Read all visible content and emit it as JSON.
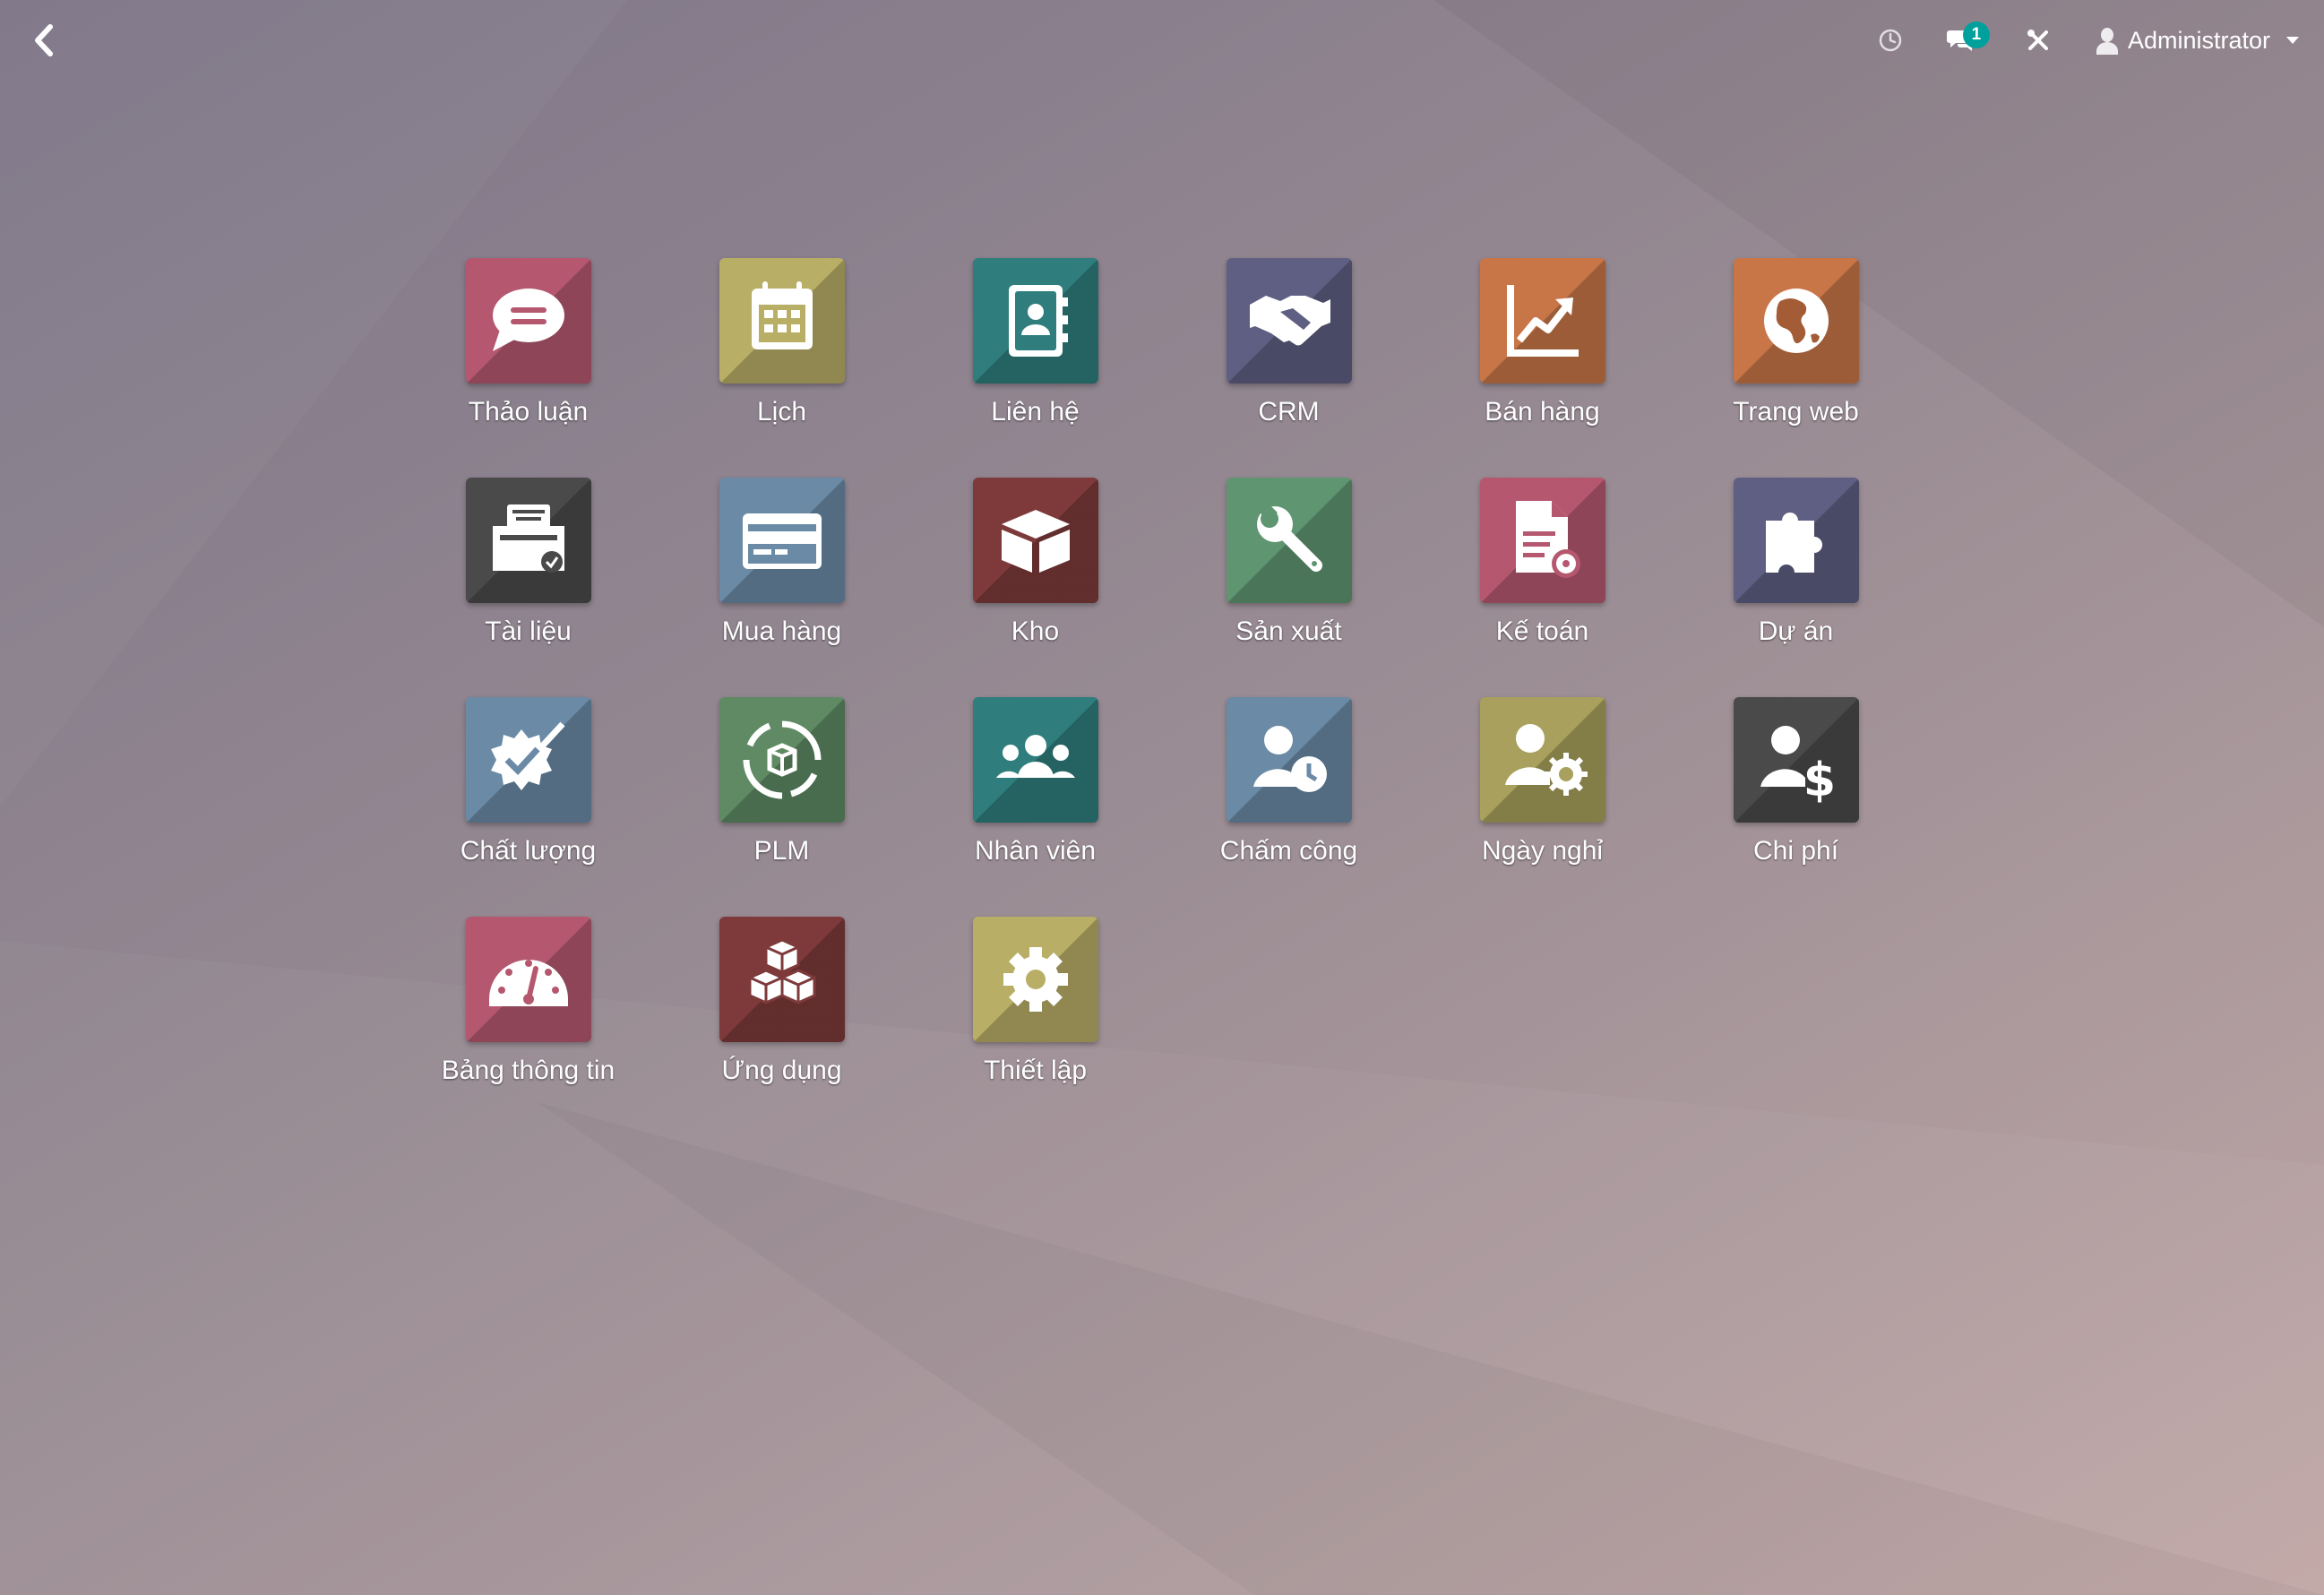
{
  "topbar": {
    "back_icon": "chevron-left-icon",
    "clock_icon": "clock-icon",
    "chat_icon": "chat-bubbles-icon",
    "chat_badge": "1",
    "debug_icon": "debug-tools-icon",
    "user_icon": "user-avatar-icon",
    "user_name": "Administrator"
  },
  "apps": [
    {
      "label": "Thảo luận",
      "icon": "discuss-chat-icon",
      "color": "#b5586f"
    },
    {
      "label": "Lịch",
      "icon": "calendar-icon",
      "color": "#b8ae66"
    },
    {
      "label": "Liên hệ",
      "icon": "contacts-book-icon",
      "color": "#2f7d7d"
    },
    {
      "label": "CRM",
      "icon": "handshake-icon",
      "color": "#5e5f82"
    },
    {
      "label": "Bán hàng",
      "icon": "sales-chart-icon",
      "color": "#c87648"
    },
    {
      "label": "Trang web",
      "icon": "globe-icon",
      "color": "#c87648"
    },
    {
      "label": "Tài liệu",
      "icon": "documents-tray-icon",
      "color": "#4a4a4a"
    },
    {
      "label": "Mua hàng",
      "icon": "credit-card-icon",
      "color": "#6a8aa5"
    },
    {
      "label": "Kho",
      "icon": "box-icon",
      "color": "#7e3a3a"
    },
    {
      "label": "Sản xuất",
      "icon": "wrench-icon",
      "color": "#5f9671"
    },
    {
      "label": "Kế toán",
      "icon": "invoice-gear-icon",
      "color": "#b5586f"
    },
    {
      "label": "Dự án",
      "icon": "puzzle-icon",
      "color": "#5e5f82"
    },
    {
      "label": "Chất lượng",
      "icon": "quality-badge-icon",
      "color": "#6a8aa5"
    },
    {
      "label": "PLM",
      "icon": "plm-cycle-icon",
      "color": "#5f8a64"
    },
    {
      "label": "Nhân viên",
      "icon": "employees-icon",
      "color": "#2f7d7d"
    },
    {
      "label": "Chấm công",
      "icon": "attendance-clock-icon",
      "color": "#6a8aa5"
    },
    {
      "label": "Ngày nghỉ",
      "icon": "time-off-gear-icon",
      "color": "#a8a05c"
    },
    {
      "label": "Chi phí",
      "icon": "expense-dollar-icon",
      "color": "#4a4a4a"
    },
    {
      "label": "Bảng thông tin",
      "icon": "dashboard-gauge-icon",
      "color": "#b5586f"
    },
    {
      "label": "Ứng dụng",
      "icon": "apps-cubes-icon",
      "color": "#7e3a3a"
    },
    {
      "label": "Thiết lập",
      "icon": "settings-gear-icon",
      "color": "#b8ae66"
    }
  ]
}
